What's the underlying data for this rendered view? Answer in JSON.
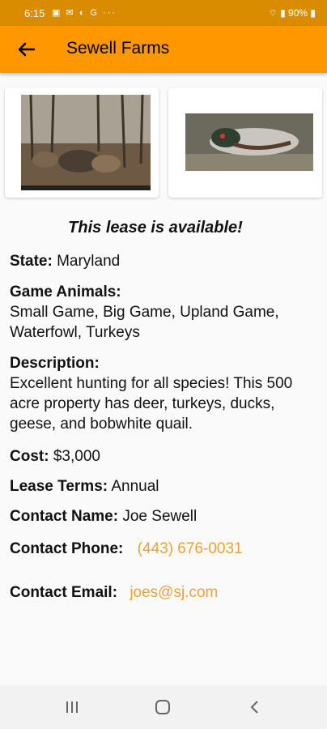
{
  "status_bar": {
    "time": "6:15",
    "battery": "90%"
  },
  "app_bar": {
    "title": "Sewell Farms"
  },
  "lease": {
    "availability": "This lease is available!",
    "state_label": "State:",
    "state_value": "Maryland",
    "game_label": "Game Animals:",
    "game_value": "Small Game, Big Game, Upland Game, Waterfowl, Turkeys",
    "desc_label": "Description:",
    "desc_value": "Excellent hunting for all species!  This 500 acre property has deer, turkeys, ducks, geese, and bobwhite quail.",
    "cost_label": "Cost:",
    "cost_value": "$3,000",
    "terms_label": "Lease Terms:",
    "terms_value": "Annual",
    "contact_name_label": "Contact Name:",
    "contact_name_value": "Joe Sewell",
    "contact_phone_label": "Contact Phone:",
    "contact_phone_value": "(443) 676-0031",
    "contact_email_label": "Contact Email:",
    "contact_email_value": "joes@sj.com"
  },
  "colors": {
    "appbar": "#ff9800",
    "statusbar": "#d98c00",
    "link": "#f0a030"
  }
}
